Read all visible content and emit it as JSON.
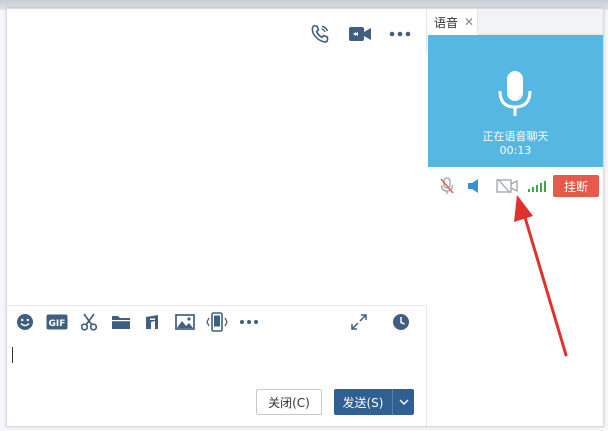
{
  "icons": {
    "chat_header": [
      "phone-icon",
      "video-icon",
      "more-icon"
    ],
    "toolbar": [
      "emoji-icon",
      "gif-icon",
      "scissors-icon",
      "folder-icon",
      "music-icon",
      "image-icon",
      "phone-shake-icon",
      "more-icon"
    ],
    "toolbar_right": [
      "expand-icon",
      "clock-icon"
    ],
    "call": [
      "microphone-icon"
    ],
    "call_controls": [
      "mic-muted-icon",
      "speaker-icon",
      "camera-off-icon",
      "signal-icon"
    ]
  },
  "colors": {
    "accent": "#2f5f93",
    "call_bg": "#55b7e2",
    "hangup": "#e55a4d",
    "icon": "#3f5e80",
    "arrow": "#e0322d"
  },
  "toolbar": {
    "gif_text": "GIF"
  },
  "buttons": {
    "close_label": "关闭(C)",
    "send_label": "发送(S)"
  },
  "voice_panel": {
    "tab_label": "语音",
    "status": "正在语音聊天",
    "timer": "00:13",
    "hangup_label": "挂断"
  }
}
